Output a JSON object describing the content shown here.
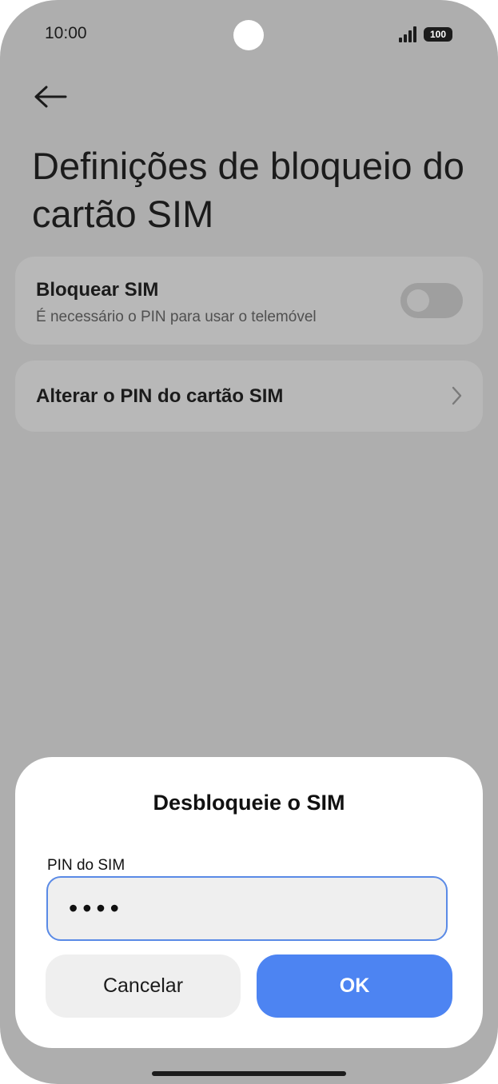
{
  "status_bar": {
    "time": "10:00",
    "battery_level": "100",
    "icons": [
      "signal-icon",
      "battery-icon"
    ]
  },
  "header": {
    "back_icon": "arrow-left-icon",
    "title": "Definições de bloqueio do cartão SIM"
  },
  "settings": {
    "lock_sim": {
      "title": "Bloquear SIM",
      "subtitle": "É necessário o PIN para usar o telemóvel",
      "enabled": false
    },
    "change_pin": {
      "title": "Alterar o PIN do cartão SIM",
      "icon": "chevron-right-icon"
    }
  },
  "dialog": {
    "title": "Desbloqueie o SIM",
    "field_label": "PIN do SIM",
    "pin_value": "••••",
    "cancel_label": "Cancelar",
    "ok_label": "OK"
  },
  "colors": {
    "scrim_background": "#aeaeae",
    "accent": "#4d84f2",
    "input_border": "#5a8ae6"
  }
}
